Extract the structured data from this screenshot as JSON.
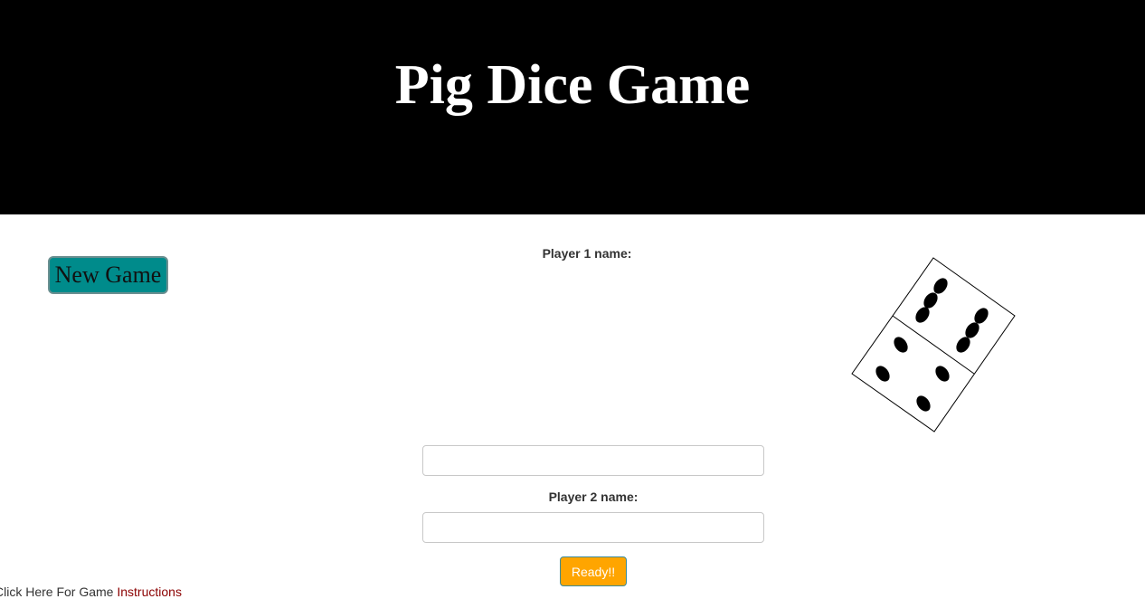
{
  "header": {
    "title": "Pig Dice Game"
  },
  "controls": {
    "new_game_label": "New Game",
    "ready_label": "Ready!!"
  },
  "form": {
    "player1_label": "Player 1 name:",
    "player1_value": "",
    "player2_label": "Player 2 name:",
    "player2_value": ""
  },
  "footer": {
    "instructions_prefix": "Click Here For Game ",
    "instructions_link": "Instructions"
  },
  "colors": {
    "header_bg": "#000000",
    "new_game_bg": "#008b8b",
    "ready_bg": "#ffa500",
    "link": "#8b0000"
  },
  "icons": {
    "dice": "dice-icon"
  }
}
